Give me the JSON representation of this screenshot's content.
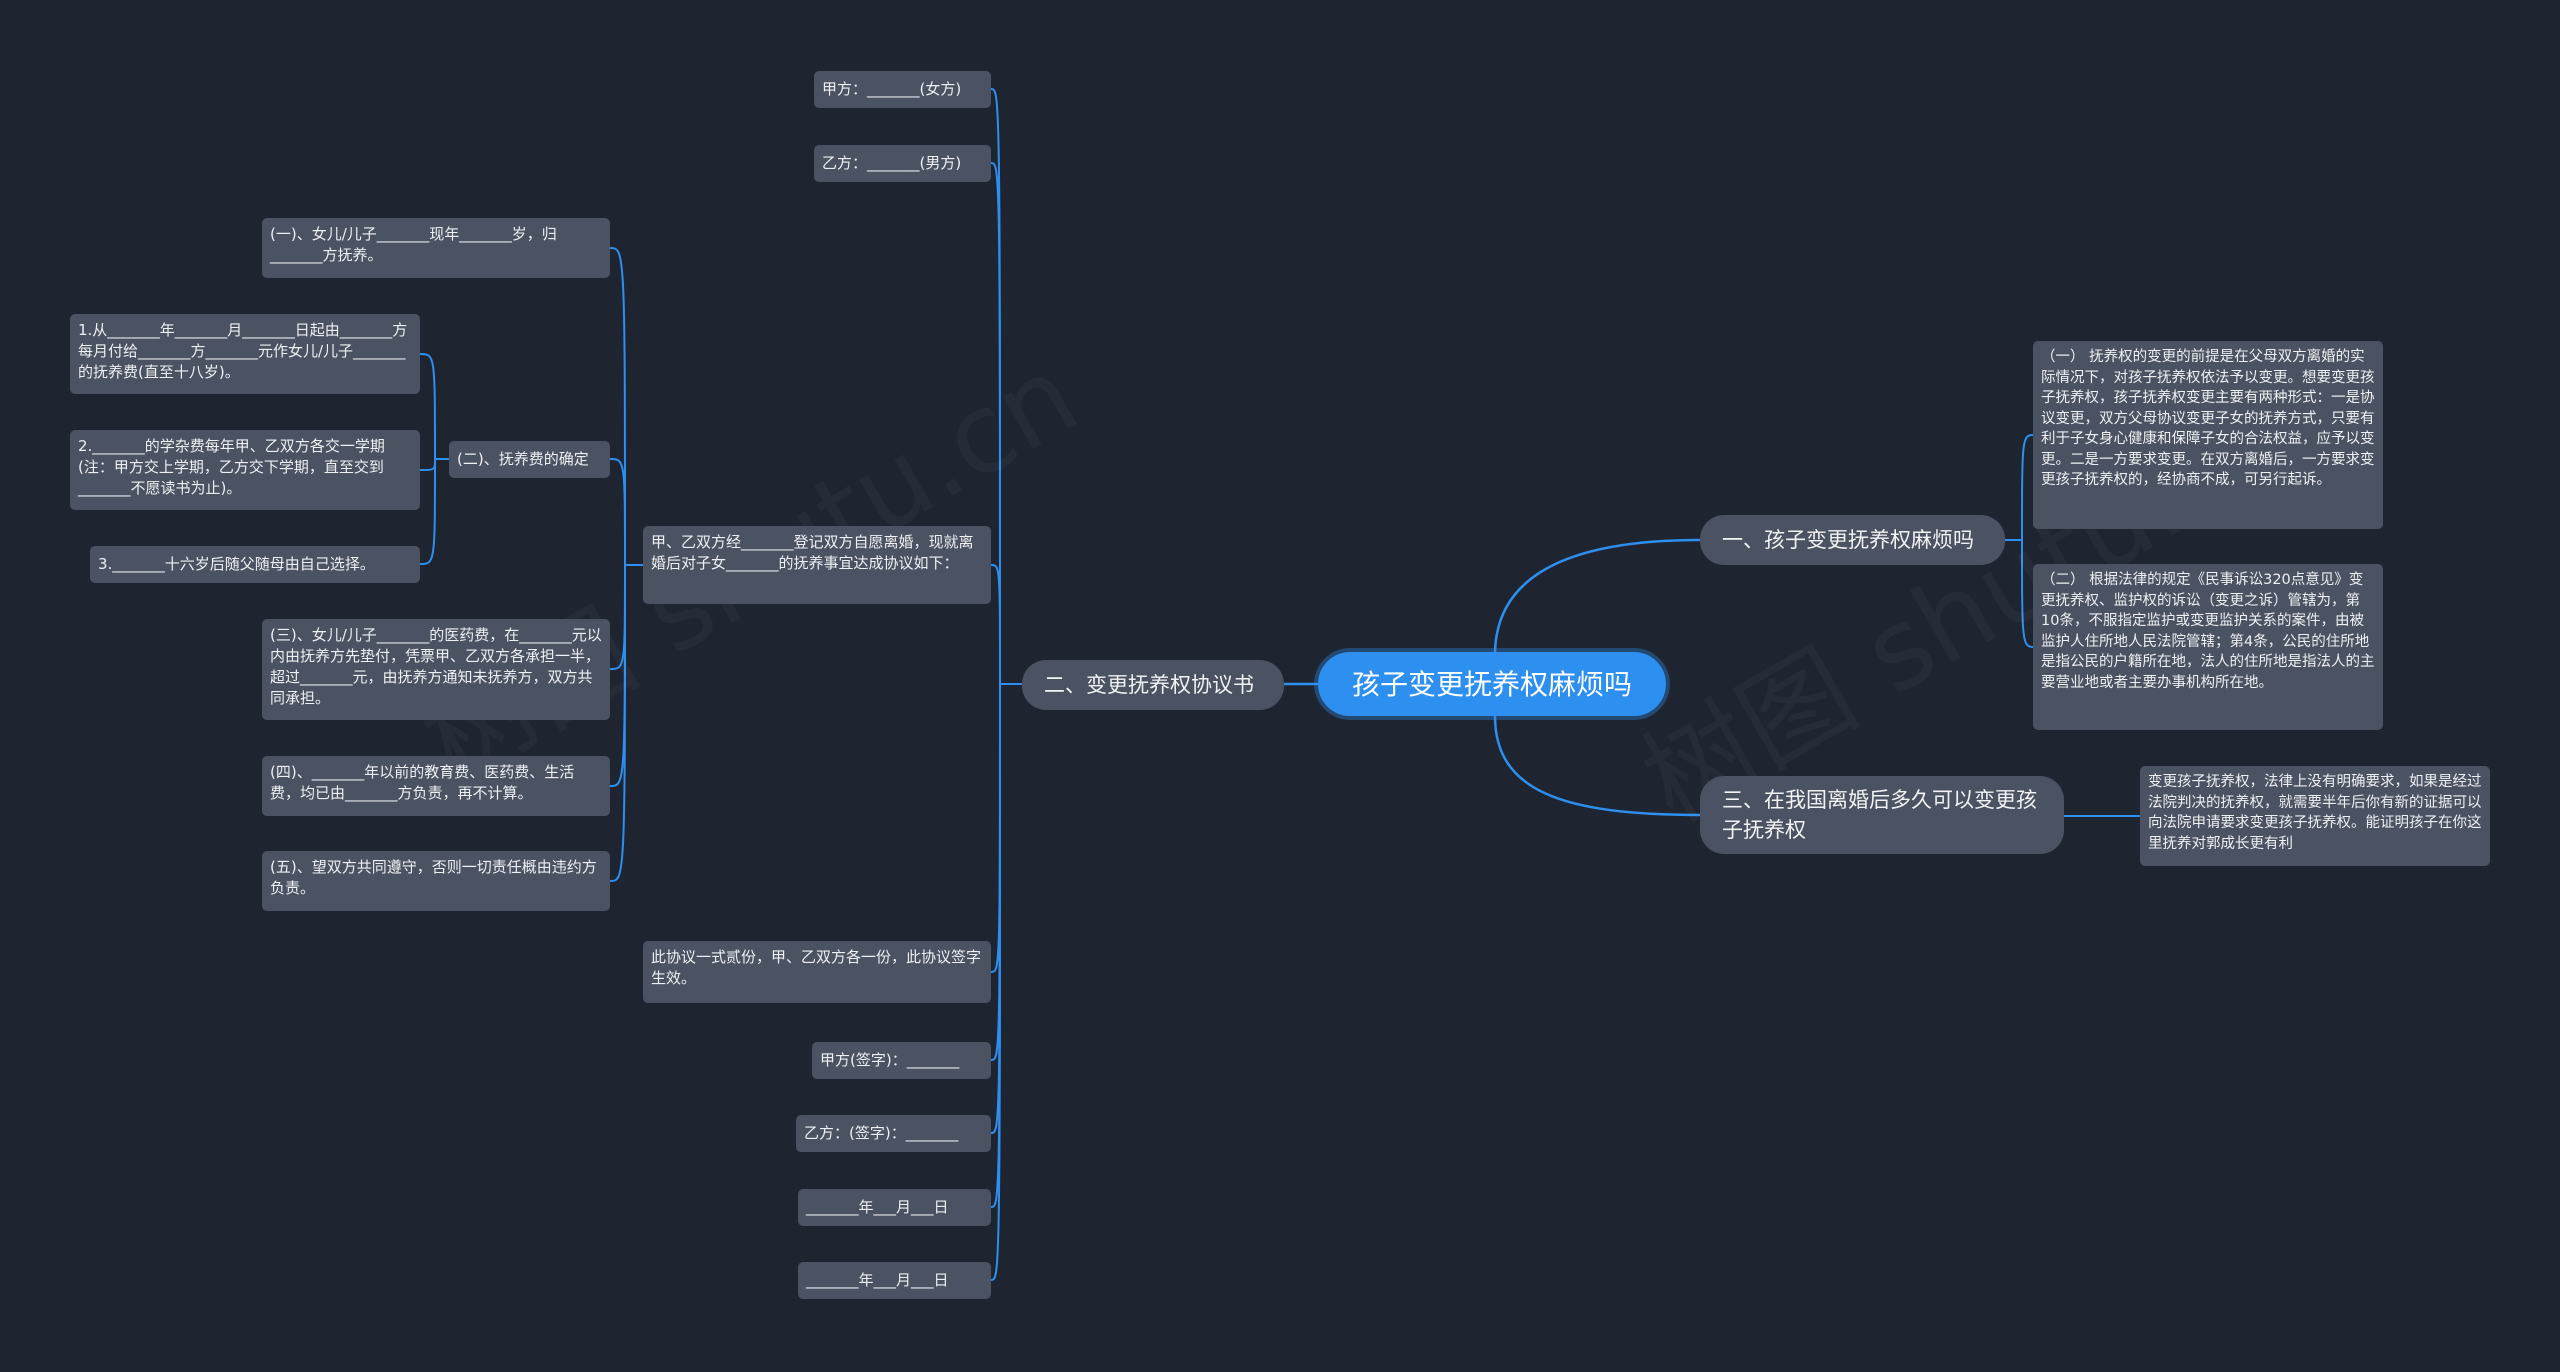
{
  "colors": {
    "background": "#1f2431",
    "node": "#4b5262",
    "root": "#2d8ff0",
    "line": "#2d8ff0",
    "text": "#eef0f3"
  },
  "root": "孩子变更抚养权麻烦吗",
  "right": {
    "b1": {
      "label": "一、孩子变更抚养权麻烦吗",
      "c1": "（一） 抚养权的变更的前提是在父母双方离婚的实际情况下，对孩子抚养权依法予以变更。想要变更孩子抚养权，孩子抚养权变更主要有两种形式：一是协议变更，双方父母协议变更子女的抚养方式，只要有利于子女身心健康和保障子女的合法权益，应予以变更。二是一方要求变更。在双方离婚后，一方要求变更孩子抚养权的，经协商不成，可另行起诉。",
      "c2": "（二） 根据法律的规定《民事诉讼320点意见》变更抚养权、监护权的诉讼（变更之诉）管辖为，第10条，不服指定监护或变更监护关系的案件，由被监护人住所地人民法院管辖；第4条，公民的住所地是指公民的户籍所在地，法人的住所地是指法人的主要营业地或者主要办事机构所在地。"
    },
    "b3": {
      "label": "三、在我国离婚后多久可以变更孩子抚养权",
      "c1": "变更孩子抚养权，法律上没有明确要求，如果是经过法院判决的抚养权，就需要半年后你有新的证据可以向法院申请要求变更孩子抚养权。能证明孩子在你这里抚养对郭成长更有利"
    }
  },
  "left": {
    "b2": {
      "label": "二、变更抚养权协议书",
      "jia": "甲方：_______(女方)",
      "yi": "乙方：_______(男方)",
      "intro": "甲、乙双方经_______登记双方自愿离婚，现就离婚后对子女_______的抚养事宜达成协议如下：",
      "items": {
        "one": "(一)、女儿/儿子_______现年_______岁，归_______方抚养。",
        "two": "(二)、抚养费的确定",
        "two_a": "1.从_______年_______月_______日起由_______方每月付给_______方_______元作女儿/儿子_______的抚养费(直至十八岁)。",
        "two_b": "2._______的学杂费每年甲、乙双方各交一学期(注：甲方交上学期，乙方交下学期，直至交到_______不愿读书为止)。",
        "two_c": "3._______十六岁后随父随母由自己选择。",
        "three": "(三)、女儿/儿子_______的医药费，在_______元以内由抚养方先垫付，凭票甲、乙双方各承担一半，超过_______元，由抚养方通知未抚养方，双方共同承担。",
        "four": "(四)、_______年以前的教育费、医药费、生活费，均已由_______方负责，再不计算。",
        "five": "(五)、望双方共同遵守，否则一切责任概由违约方负责。"
      },
      "copies": "此协议一式贰份，甲、乙双方各一份，此协议签字生效。",
      "sign_jia": "甲方(签字)：_______",
      "sign_yi": "乙方：(签字)：_______",
      "date1": "_______年___月___日",
      "date2": "_______年___月___日"
    }
  },
  "watermark": "树图 shutu.cn"
}
